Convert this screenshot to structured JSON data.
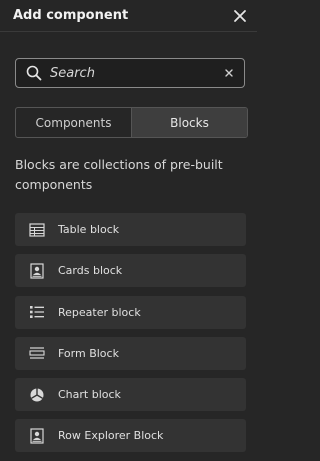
{
  "header": {
    "title": "Add component",
    "close_icon": "close-icon"
  },
  "search": {
    "placeholder": "Search",
    "value": ""
  },
  "tabs": [
    {
      "label": "Components",
      "active": false
    },
    {
      "label": "Blocks",
      "active": true
    }
  ],
  "description": "Blocks are collections of pre-built components",
  "blocks": [
    {
      "label": "Table block",
      "icon": "table-icon"
    },
    {
      "label": "Cards block",
      "icon": "cards-icon"
    },
    {
      "label": "Repeater block",
      "icon": "list-icon"
    },
    {
      "label": "Form Block",
      "icon": "form-icon"
    },
    {
      "label": "Chart block",
      "icon": "pie-chart-icon"
    },
    {
      "label": "Row Explorer Block",
      "icon": "row-explorer-icon"
    }
  ],
  "colors": {
    "background": "#262626",
    "item": "#333333",
    "text": "#e6e6e6"
  }
}
